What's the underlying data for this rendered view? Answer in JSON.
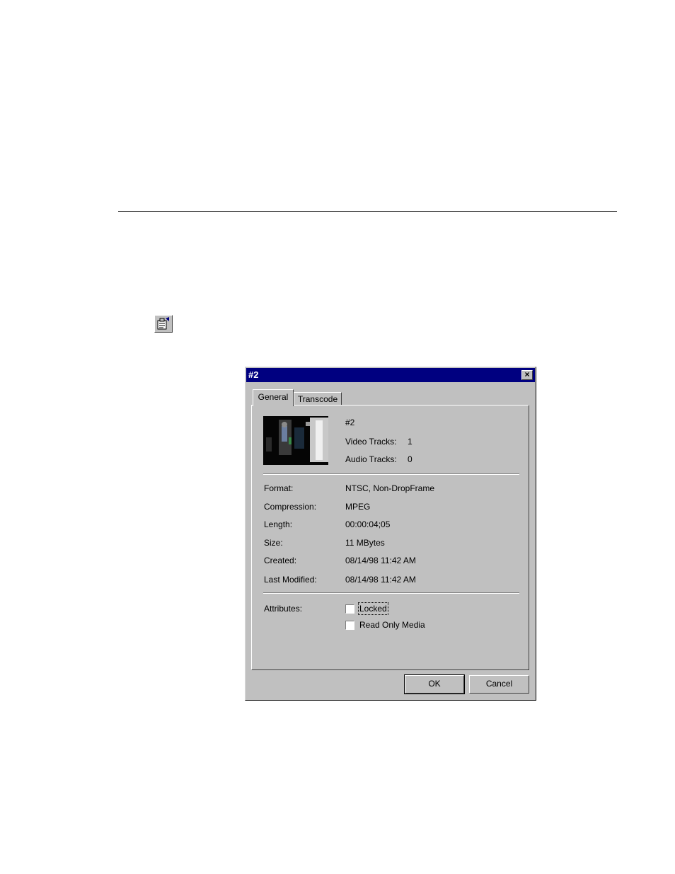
{
  "page": {
    "divider": true
  },
  "toolbar": {
    "properties_icon": "properties-icon"
  },
  "dialog": {
    "title": "#2",
    "close_icon": "close-icon",
    "tabs": [
      {
        "label": "General",
        "active": true
      },
      {
        "label": "Transcode",
        "active": false
      }
    ],
    "header": {
      "name": "#2",
      "video_tracks_label": "Video Tracks:",
      "video_tracks_value": "1",
      "audio_tracks_label": "Audio Tracks:",
      "audio_tracks_value": "0"
    },
    "properties": [
      {
        "label": "Format:",
        "value": "NTSC, Non-DropFrame"
      },
      {
        "label": "Compression:",
        "value": "MPEG"
      },
      {
        "label": "Length:",
        "value": "00:00:04;05"
      },
      {
        "label": "Size:",
        "value": "11 MBytes"
      },
      {
        "label": "Created:",
        "value": "08/14/98 11:42 AM"
      },
      {
        "label": "Last Modified:",
        "value": "08/14/98 11:42 AM"
      }
    ],
    "attributes": {
      "label": "Attributes:",
      "options": [
        {
          "label": "Locked",
          "checked": false
        },
        {
          "label": "Read Only Media",
          "checked": false
        }
      ]
    },
    "buttons": {
      "ok": "OK",
      "cancel": "Cancel"
    }
  }
}
